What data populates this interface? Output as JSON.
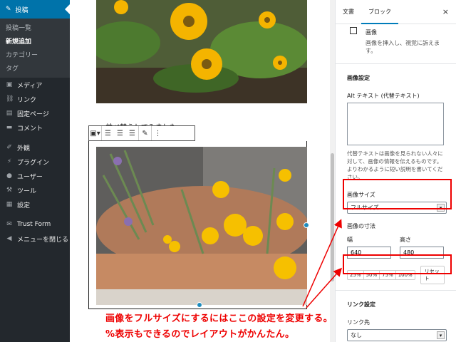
{
  "admin_menu": {
    "current": "投稿",
    "sub_items": [
      {
        "label": "投稿一覧",
        "bold": false
      },
      {
        "label": "新規追加",
        "bold": true
      },
      {
        "label": "カテゴリー",
        "bold": false
      },
      {
        "label": "タグ",
        "bold": false
      }
    ],
    "items": [
      {
        "label": "メディア",
        "icon": "media-icon"
      },
      {
        "label": "リンク",
        "icon": "link-icon"
      },
      {
        "label": "固定ページ",
        "icon": "page-icon"
      },
      {
        "label": "コメント",
        "icon": "comment-icon"
      }
    ],
    "items2": [
      {
        "label": "外観",
        "icon": "brush-icon"
      },
      {
        "label": "プラグイン",
        "icon": "plugin-icon"
      },
      {
        "label": "ユーザー",
        "icon": "user-icon"
      },
      {
        "label": "ツール",
        "icon": "wrench-icon"
      },
      {
        "label": "設定",
        "icon": "settings-icon"
      }
    ],
    "items3": [
      {
        "label": "Trust Form",
        "icon": "form-icon"
      },
      {
        "label": "メニューを閉じる",
        "icon": "collapse-icon"
      }
    ]
  },
  "editor": {
    "caption": "… 並べ替えしてみました。"
  },
  "panel": {
    "tab_document": "文書",
    "tab_block": "ブロック",
    "close_icon": "×",
    "block_title": "画像",
    "block_desc": "画像を挿入し、視覚に訴えます。",
    "image_settings_title": "画像設定",
    "alt_label": "Alt テキスト (代替テキスト)",
    "alt_help": "代替テキストは画像を見られない人々に対して、画像の情報を伝えるものです。よりわかるように短い説明を書いてください。",
    "size_label": "画像サイズ",
    "size_value": "フルサイズ",
    "dims_label": "画像の寸法",
    "width_label": "幅",
    "width_value": "640",
    "height_label": "高さ",
    "height_value": "480",
    "pct_buttons": [
      "25%",
      "50%",
      "75%",
      "100%"
    ],
    "reset_label": "リセット",
    "link_settings_title": "リンク設定",
    "link_to_label": "リンク先",
    "link_to_value": "なし"
  },
  "annotations": {
    "line1": "画像をフルサイズにするにはここの設定を変更する。",
    "line2": "%表示もできるのでレイアウトがかんたん。"
  },
  "colors": {
    "admin_bg": "#23282d",
    "admin_active": "#0073aa",
    "accent": "#007cba",
    "annotation_red": "#ee0000"
  }
}
